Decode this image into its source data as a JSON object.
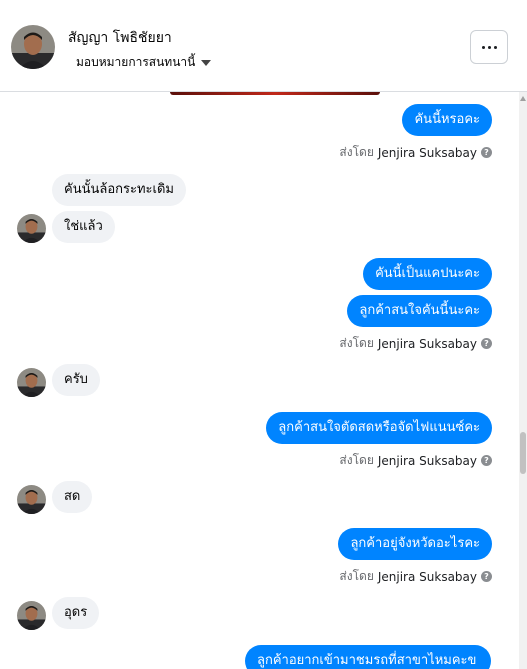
{
  "contact": {
    "name": "สัญญา โพธิชัยยา",
    "assign_label": "มอบหมายการสนทนานี้"
  },
  "messages": [
    {
      "text": "คันนี้หรอคะ"
    },
    {
      "sent_by_prefix": "ส่งโดย",
      "agent": "Jenjira Suksabay"
    },
    {
      "text": "คันนั้นล้อกระทะเดิม"
    },
    {
      "text": "ใช่แล้ว"
    },
    {
      "text": "คันนี้เป็นแคปนะคะ"
    },
    {
      "text": "ลูกค้าสนใจคันนี้นะคะ"
    },
    {
      "sent_by_prefix": "ส่งโดย",
      "agent": "Jenjira Suksabay"
    },
    {
      "text": "ครับ"
    },
    {
      "text": "ลูกค้าสนใจตัดสดหรือจัดไฟแนนซ์คะ"
    },
    {
      "sent_by_prefix": "ส่งโดย",
      "agent": "Jenjira Suksabay"
    },
    {
      "text": "สด"
    },
    {
      "text": "ลูกค้าอยู่จังหวัดอะไรคะ"
    },
    {
      "sent_by_prefix": "ส่งโดย",
      "agent": "Jenjira Suksabay"
    },
    {
      "text": "อุดร"
    },
    {
      "text": "ลูกค้าอยากเข้ามาชมรถที่สาขาไหมคะข"
    }
  ],
  "icons": {
    "more": "more-dots-icon",
    "info": "info-icon",
    "caret": "caret-down-icon"
  },
  "colors": {
    "outgoing_bubble": "#0084ff",
    "incoming_bubble": "#f0f2f5",
    "meta_text": "#65676b"
  }
}
